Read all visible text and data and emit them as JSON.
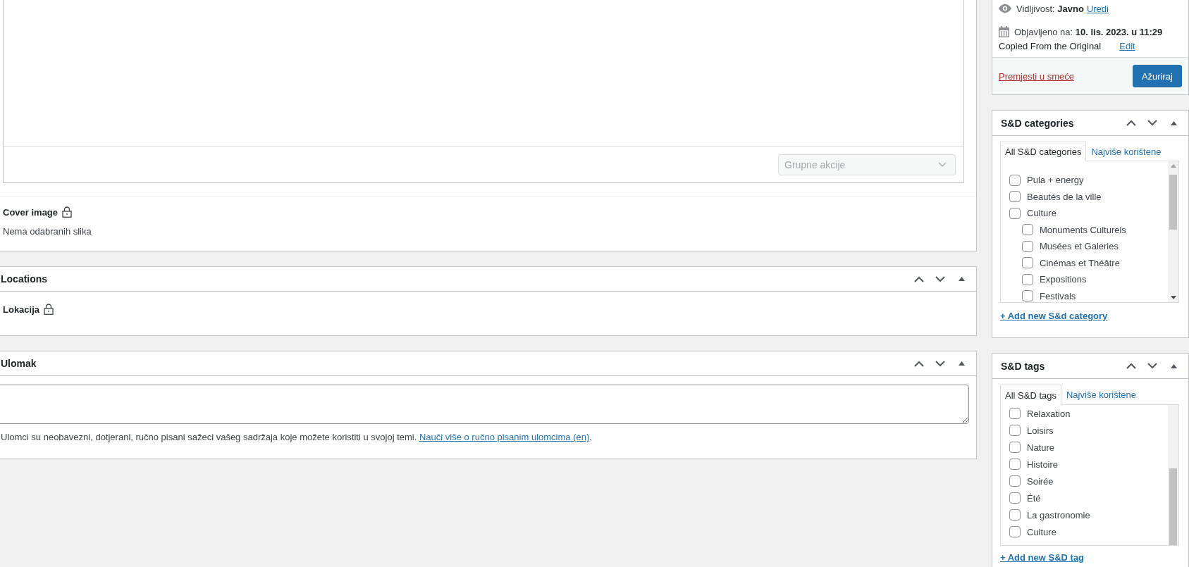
{
  "editor_panel": {
    "bulk_actions": {
      "value": "Grupne akcije",
      "disabled": true
    },
    "cover_image": {
      "label": "Cover image",
      "locked": true,
      "value": "Nema odabranih slika"
    }
  },
  "locations_panel": {
    "title": "Locations",
    "fields": [
      {
        "label": "Lokacija",
        "locked": true
      }
    ]
  },
  "excerpt_panel": {
    "title": "Ulomak",
    "description": "Ulomci su neobavezni, dotjerani, ručno pisani sažeci vašeg sadržaja koje možete koristiti u svojoj temi.",
    "link": "Nauči više o ručno pisanim ulomcima (en)",
    "description_end": "."
  },
  "publish_panel": {
    "visibility": {
      "label": "Vidljivost:",
      "value": "Javno",
      "link": "Uredi"
    },
    "published": {
      "label": "Objavljeno na:",
      "value": "10. lis. 2023. u 11:29"
    },
    "copied": {
      "text": "Copied From the Original",
      "link": "Edit"
    },
    "trash_link": "Premjesti u smeće",
    "update_button": "Ažuriraj"
  },
  "categories_panel": {
    "title": "S&D categories",
    "tabs": [
      {
        "label": "All S&D categories",
        "selected": true
      },
      {
        "label": "Najviše korištene",
        "selected": false
      }
    ],
    "items": [
      {
        "label": "Pula + energy",
        "checked": false
      },
      {
        "label": "Beautés de la ville",
        "checked": false
      },
      {
        "label": "Culture",
        "checked": false,
        "children": [
          {
            "label": "Monuments Culturels",
            "checked": false
          },
          {
            "label": "Musées et Galeries",
            "checked": false
          },
          {
            "label": "Cinémas et Théâtre",
            "checked": false
          },
          {
            "label": "Expositions",
            "checked": false
          },
          {
            "label": "Festivals",
            "checked": false
          }
        ]
      }
    ],
    "add_link": "+ Add new S&d category"
  },
  "tags_panel": {
    "title": "S&D tags",
    "tabs": [
      {
        "label": "All S&D tags",
        "selected": true
      },
      {
        "label": "Najviše korištene",
        "selected": false
      }
    ],
    "items": [
      {
        "label": "Relaxation",
        "checked": false
      },
      {
        "label": "Loisirs",
        "checked": false
      },
      {
        "label": "Nature",
        "checked": false
      },
      {
        "label": "Histoire",
        "checked": false
      },
      {
        "label": "Soirée",
        "checked": false
      },
      {
        "label": "Été",
        "checked": false
      },
      {
        "label": "La gastronomie",
        "checked": false
      },
      {
        "label": "Culture",
        "checked": false
      }
    ],
    "add_link": "+ Add new S&D tag"
  }
}
